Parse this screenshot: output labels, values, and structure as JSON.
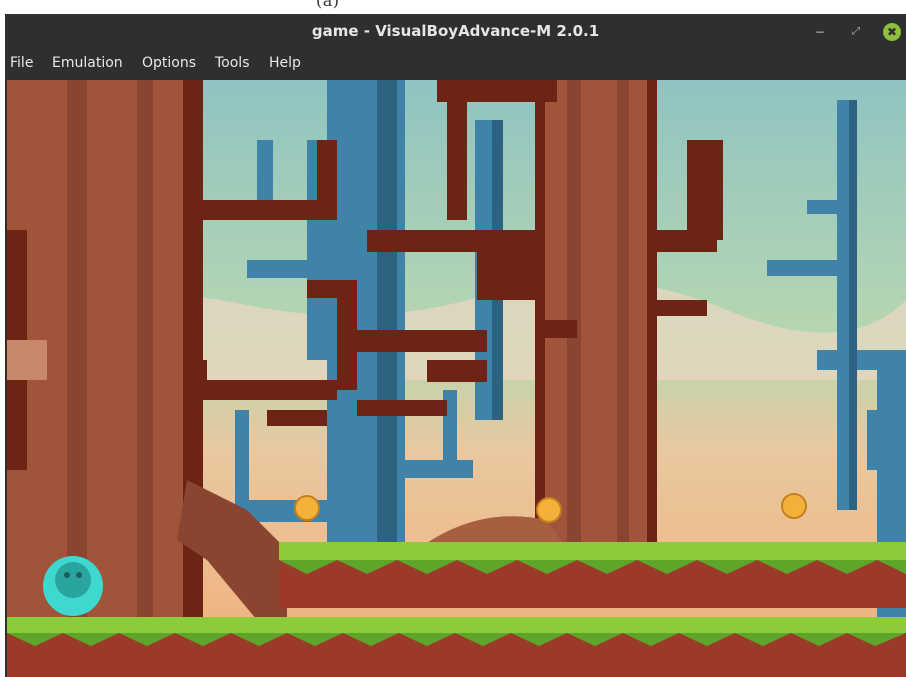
{
  "caption": {
    "text": "(a)"
  },
  "window": {
    "title": "game - VisualBoyAdvance-M 2.0.1",
    "controls": {
      "minimize": "−",
      "maximize": "⤢",
      "close": "✖"
    }
  },
  "menu": {
    "items": [
      "File",
      "Emulation",
      "Options",
      "Tools",
      "Help"
    ]
  },
  "game": {
    "scene": "forest",
    "colors": {
      "sky": "#9cc6b8",
      "sand": "#f0b07a",
      "trunk": "#a0553a",
      "trunk_dark": "#6e2414",
      "blue_tree": "#3f84a8",
      "grass": "#8ccc3a",
      "ground": "#9c3a2a",
      "player": "#3fd8d0",
      "coin": "#f2b23a"
    }
  }
}
